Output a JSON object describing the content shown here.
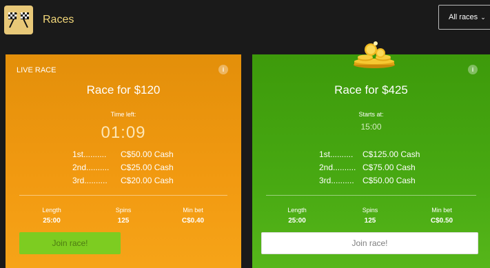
{
  "header": {
    "logo_icon": "checkered-flags-icon",
    "title": "Races",
    "filter": {
      "label": "All races",
      "icon": "chevron-down-icon"
    }
  },
  "races": [
    {
      "tag": "LIVE RACE",
      "title": "Race for $120",
      "time_label": "Time left:",
      "time_value": "01:09",
      "prizes": [
        {
          "place": "1st..........",
          "amount": "C$50.00 Cash"
        },
        {
          "place": "2nd..........",
          "amount": "C$25.00 Cash"
        },
        {
          "place": "3rd..........",
          "amount": "C$20.00 Cash"
        }
      ],
      "stats": [
        {
          "label": "Length",
          "value": "25:00"
        },
        {
          "label": "Spins",
          "value": "125"
        },
        {
          "label": "Min bet",
          "value": "C$0.40"
        }
      ],
      "join_label": "Join race!",
      "accent": "#f29a11"
    },
    {
      "tag": "",
      "title": "Race for $425",
      "time_label": "Starts at:",
      "time_value": "15:00",
      "prizes": [
        {
          "place": "1st..........",
          "amount": "C$125.00 Cash"
        },
        {
          "place": "2nd..........",
          "amount": "C$75.00 Cash"
        },
        {
          "place": "3rd..........",
          "amount": "C$50.00 Cash"
        }
      ],
      "stats": [
        {
          "label": "Length",
          "value": "25:00"
        },
        {
          "label": "Spins",
          "value": "125"
        },
        {
          "label": "Min bet",
          "value": "C$0.50"
        }
      ],
      "join_label": "Join race!",
      "accent": "#48a912",
      "decoration_icon": "gold-coins-icon"
    }
  ],
  "info_icon": "info-icon"
}
